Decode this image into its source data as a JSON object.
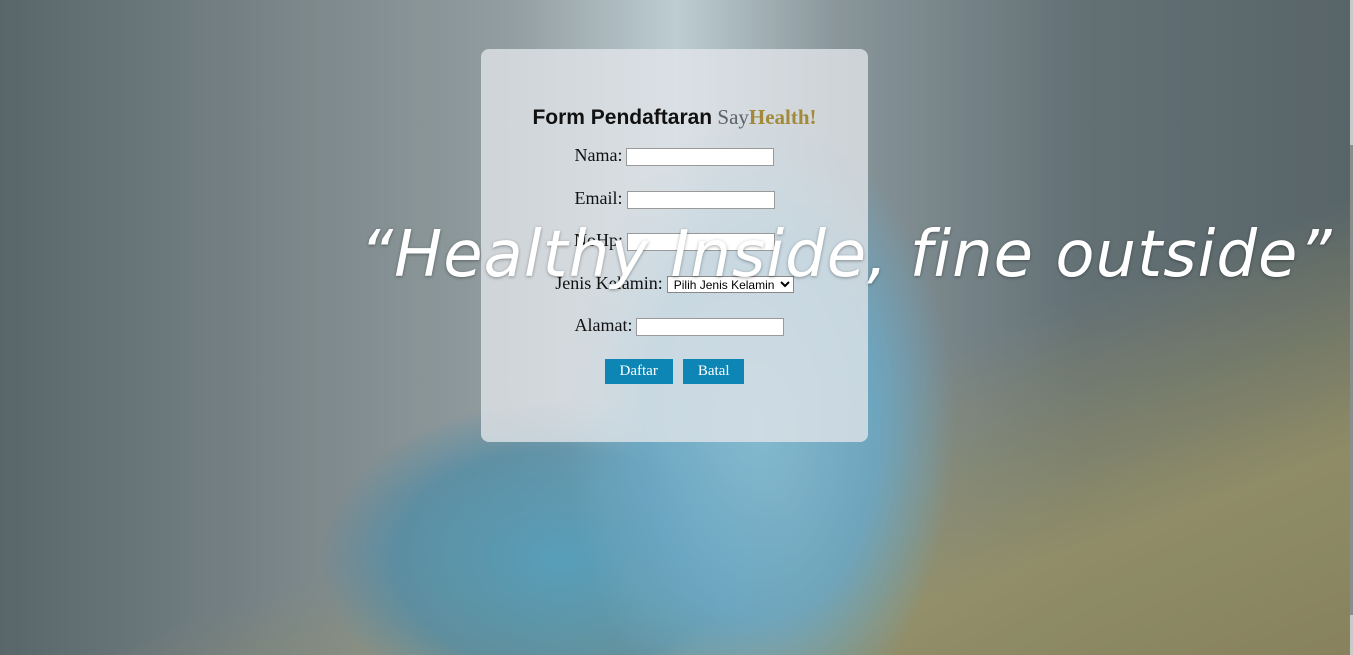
{
  "form": {
    "title_part1": "Form Pendaftaran",
    "title_part2": "Say",
    "title_part3": "Health!",
    "fields": {
      "nama_label": "Nama:",
      "email_label": "Email:",
      "nohp_label": "NoHp:",
      "gender_label": "Jenis Kelamin:",
      "gender_selected": "Pilih Jenis Kelamin",
      "alamat_label": "Alamat:"
    },
    "buttons": {
      "submit": "Daftar",
      "cancel": "Batal"
    }
  },
  "tagline": "“Healthy Inside, fine outside”",
  "colors": {
    "button_bg": "#0d86b6",
    "accent_health": "#a38a3a",
    "say_gray": "#5b6268"
  }
}
